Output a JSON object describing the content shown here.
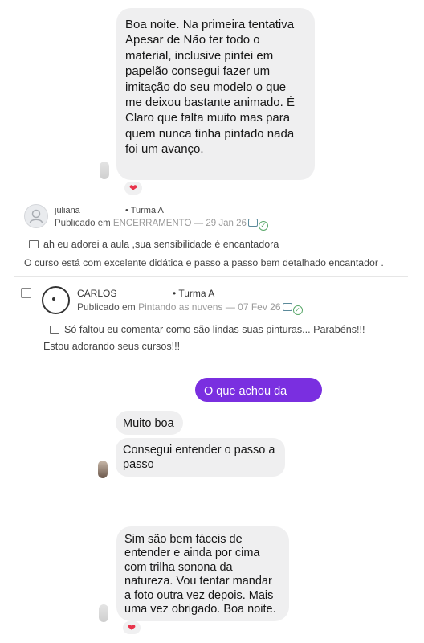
{
  "messages": {
    "m1": "Boa noite. Na primeira tentativa Apesar de Não ter todo o material, inclusive pintei em papelão consegui fazer um imitação do seu modelo o que me deixou bastante animado. É Claro que falta muito mas para quem nunca tinha pintado nada foi um avanço.",
    "sent": "O que achou da aula?",
    "r1": "Muito boa",
    "r2": "Consegui entender o passo a passo",
    "m4": "Sim são bem fáceis de entender e ainda por cima com trilha sonona da natureza. Vou tentar mandar a foto outra vez depois. Mais uma vez obrigado. Boa noite."
  },
  "reaction": {
    "icon": "heart-icon",
    "glyph": "❤"
  },
  "comments": [
    {
      "name": "juliana",
      "group": "• Turma A",
      "published": "Publicado em",
      "lesson": "ENCERRAMENTO",
      "date": "— 29 Jan 26",
      "text": "ah eu adorei a aula ,sua sensibilidade é encantadora",
      "extra": "O curso está com excelente didática e passo a passo bem detalhado encantador ."
    },
    {
      "name": "CARLOS",
      "group": "• Turma A",
      "published": "Publicado em",
      "lesson": "Pintando as nuvens",
      "date": "— 07 Fev 26",
      "text": "Só faltou eu comentar como são lindas suas pinturas... Parabéns!!!",
      "text2": "Estou adorando seus cursos!!!"
    }
  ],
  "colors": {
    "sent_bubble": "#7a2fe0",
    "received_bubble": "#efeff0",
    "heart": "#e8334b"
  }
}
